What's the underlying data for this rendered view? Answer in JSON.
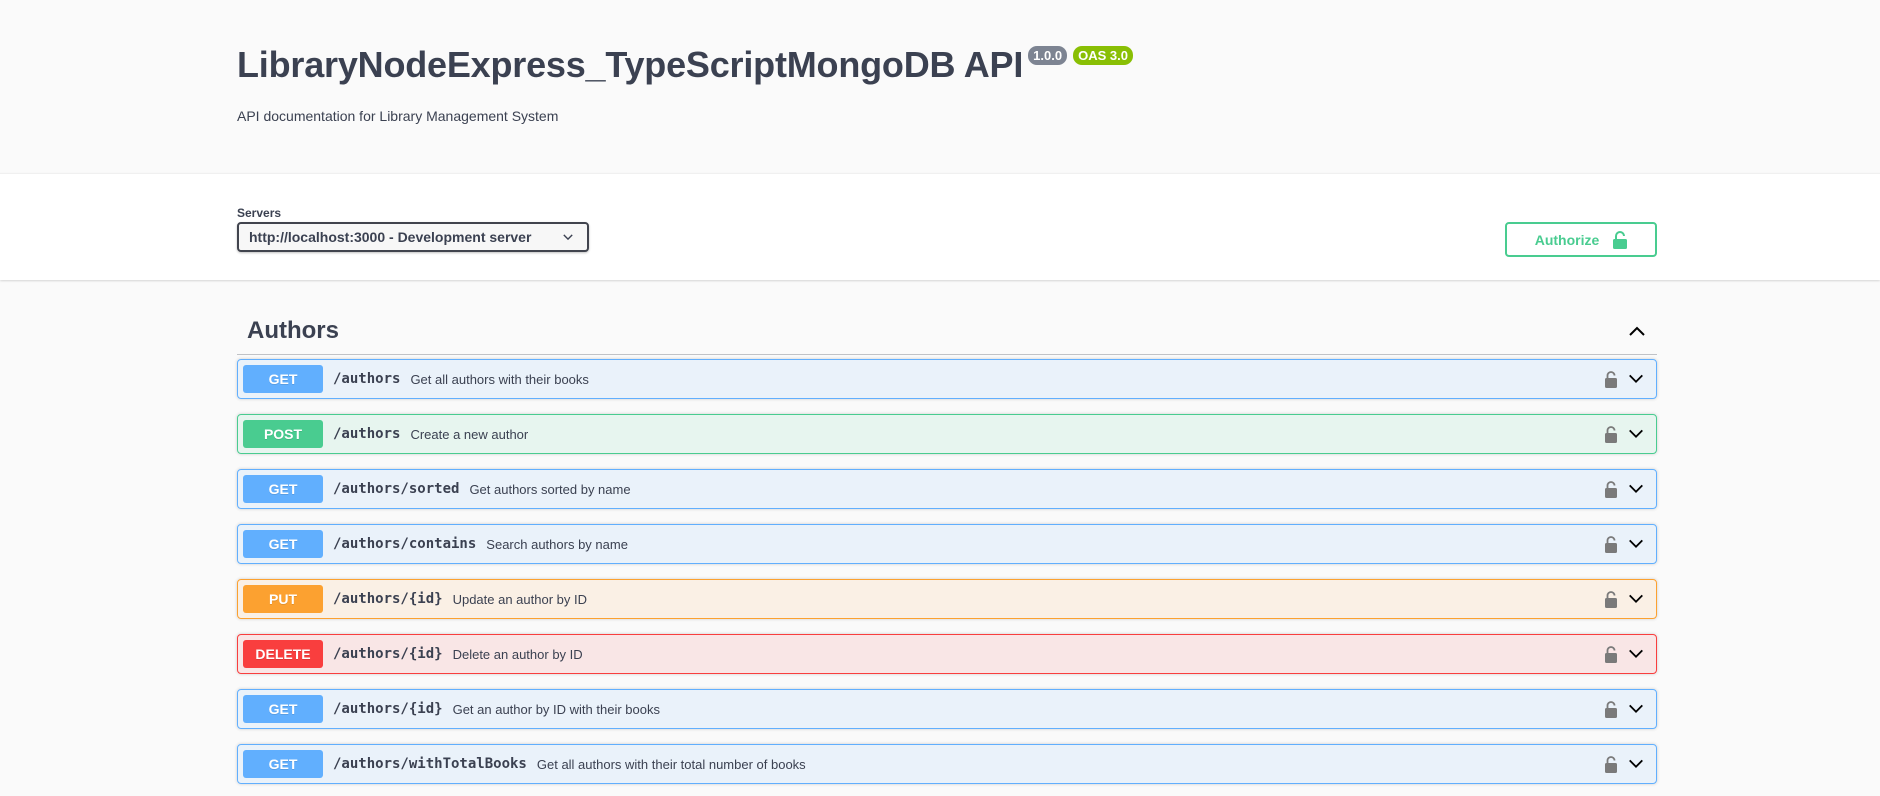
{
  "info": {
    "title": "LibraryNodeExpress_TypeScriptMongoDB API",
    "version": "1.0.0",
    "oas": "OAS 3.0",
    "description": "API documentation for Library Management System"
  },
  "servers": {
    "label": "Servers",
    "selected": "http://localhost:3000 - Development server"
  },
  "authorize": {
    "label": "Authorize"
  },
  "tag": {
    "name": "Authors"
  },
  "operations": [
    {
      "method": "GET",
      "path": "/authors",
      "summary": "Get all authors with their books"
    },
    {
      "method": "POST",
      "path": "/authors",
      "summary": "Create a new author"
    },
    {
      "method": "GET",
      "path": "/authors/sorted",
      "summary": "Get authors sorted by name"
    },
    {
      "method": "GET",
      "path": "/authors/contains",
      "summary": "Search authors by name"
    },
    {
      "method": "PUT",
      "path": "/authors/{id}",
      "summary": "Update an author by ID"
    },
    {
      "method": "DELETE",
      "path": "/authors/{id}",
      "summary": "Delete an author by ID"
    },
    {
      "method": "GET",
      "path": "/authors/{id}",
      "summary": "Get an author by ID with their books"
    },
    {
      "method": "GET",
      "path": "/authors/withTotalBooks",
      "summary": "Get all authors with their total number of books"
    }
  ],
  "colors": {
    "get": "#61affe",
    "post": "#49cc90",
    "put": "#fca130",
    "delete": "#f93e3e"
  }
}
